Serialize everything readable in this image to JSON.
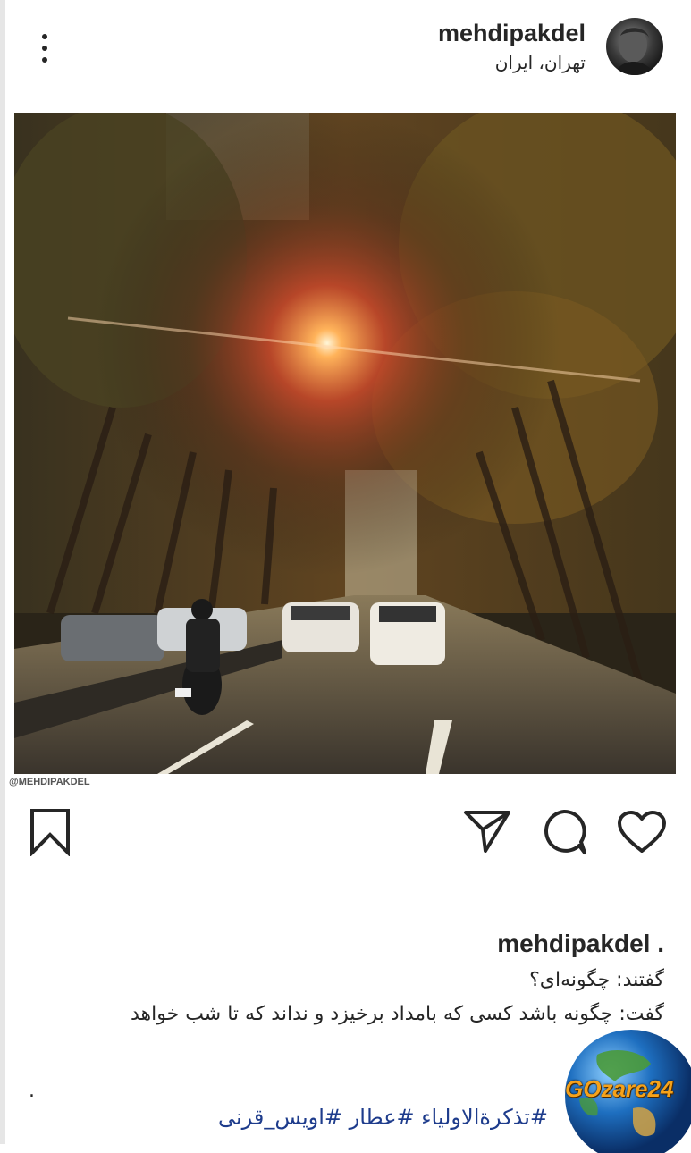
{
  "header": {
    "username": "mehdipakdel",
    "location": "تهران، ایران",
    "more_icon": "more-vertical-icon"
  },
  "post": {
    "watermark": "@MEHDIPAKDEL",
    "actions": {
      "save_icon": "bookmark-icon",
      "share_icon": "send-icon",
      "comment_icon": "comment-icon",
      "like_icon": "heart-icon"
    }
  },
  "caption": {
    "username": "mehdipakdel .",
    "line1": "گفتند: چگونه‌ای؟",
    "line2": "گفت: چگونه باشد کسی که بامداد برخیزد و نداند که تا شب خواهد",
    "dot": ".",
    "hashtags": "#تذکرةالاولیاء #عطار #اویس_قرنی"
  },
  "overlay": {
    "brand": "GOzare24"
  },
  "colors": {
    "text": "#262626",
    "hashtag": "#1e3c8c",
    "brand": "#f6a21a"
  }
}
